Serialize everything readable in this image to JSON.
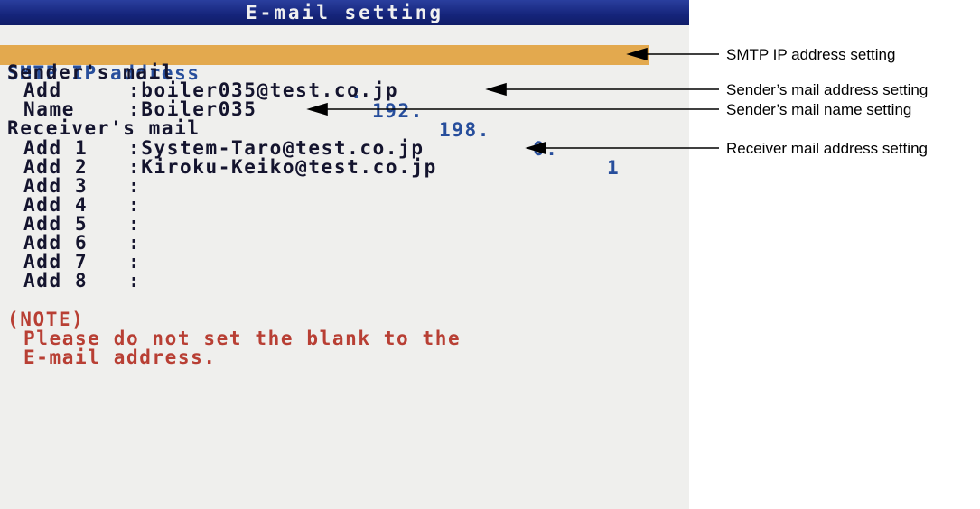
{
  "screen": {
    "title": "E-mail setting",
    "smtp": {
      "label": "SMTP IP address",
      "separator": ":",
      "octets": [
        "192.",
        "198.",
        "0.",
        "1"
      ]
    },
    "sender": {
      "heading": "Sender's mail",
      "add_label": "Add",
      "add_value": ":boiler035@test.co.jp",
      "name_label": "Name",
      "name_value": ":Boiler035"
    },
    "receiver": {
      "heading": "Receiver's mail",
      "entries": [
        {
          "label": "Add 1",
          "value": ":System-Taro@test.co.jp"
        },
        {
          "label": "Add 2",
          "value": ":Kiroku-Keiko@test.co.jp"
        },
        {
          "label": "Add 3",
          "value": ":"
        },
        {
          "label": "Add 4",
          "value": ":"
        },
        {
          "label": "Add 5",
          "value": ":"
        },
        {
          "label": "Add 6",
          "value": ":"
        },
        {
          "label": "Add 7",
          "value": ":"
        },
        {
          "label": "Add 8",
          "value": ":"
        }
      ]
    },
    "note": {
      "heading": "(NOTE)",
      "line1": "Please do not set the blank to the",
      "line2": "E-mail address."
    }
  },
  "annotations": {
    "smtp": "SMTP IP address setting",
    "sender_address": "Sender’s mail address setting",
    "sender_name": "Sender’s mail name setting",
    "receiver_address": "Receiver mail address setting"
  },
  "colors": {
    "highlight": "#e3a94e",
    "title_bar": "#15247a",
    "note_text": "#b83f34",
    "screen_bg": "#efefed"
  }
}
